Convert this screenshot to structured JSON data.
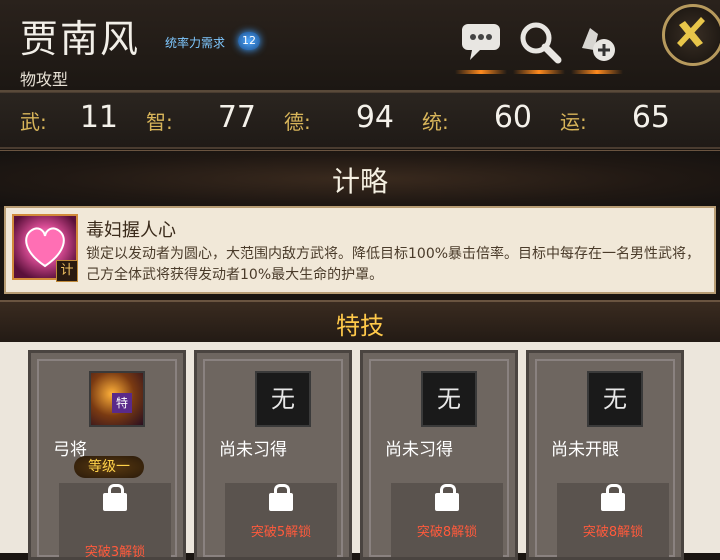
{
  "header": {
    "name": "贾南风",
    "subtype": "物攻型",
    "command_req_label": "统率力需求",
    "command_req_value": "12"
  },
  "buttons": {
    "chat_icon": "chat-icon",
    "search_icon": "search-icon",
    "add_icon": "add-icon",
    "close_icon": "close-icon"
  },
  "stats": [
    {
      "label": "武:",
      "value": "11"
    },
    {
      "label": "智:",
      "value": "77"
    },
    {
      "label": "德:",
      "value": "94"
    },
    {
      "label": "统:",
      "value": "60"
    },
    {
      "label": "运:",
      "value": "65"
    }
  ],
  "strategy": {
    "title": "计略",
    "skill_name": "毒妇握人心",
    "badge": "计",
    "description": "锁定以发动者为圆心，大范围内敌方武将。降低目标100%暴击倍率。目标中每存在一名男性武将，己方全体武将获得发动者10%最大生命的护罩。"
  },
  "specials": {
    "title": "特技",
    "cards": [
      {
        "icon_text": "",
        "tag": "特",
        "name": "弓将",
        "level": "等级一",
        "lock_text": "突破3解锁"
      },
      {
        "icon_text": "无",
        "name": "尚未习得",
        "lock_text": "突破5解锁"
      },
      {
        "icon_text": "无",
        "name": "尚未习得",
        "lock_text": "突破8解锁"
      },
      {
        "icon_text": "无",
        "name": "尚未开眼",
        "lock_text": "突破8解锁"
      }
    ]
  }
}
